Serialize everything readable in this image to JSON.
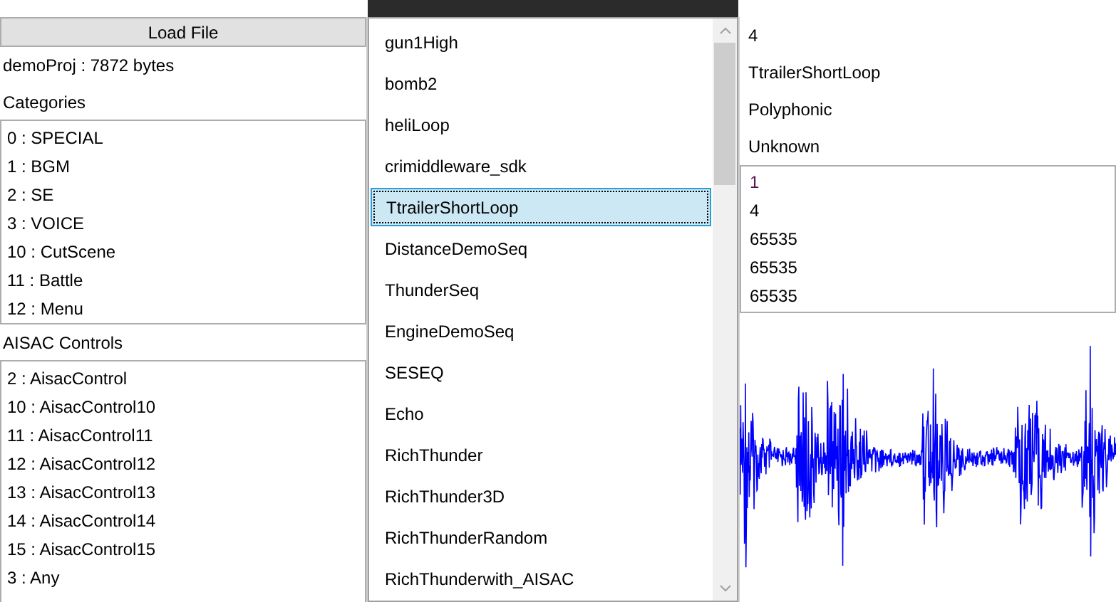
{
  "load_button": {
    "label": "Load File"
  },
  "file_info": "demoProj : 7872 bytes",
  "categories": {
    "heading": "Categories",
    "items": [
      "0 : SPECIAL",
      "1 : BGM",
      "2 : SE",
      "3 : VOICE",
      "10 : CutScene",
      "11 : Battle",
      "12 : Menu"
    ]
  },
  "aisac_controls": {
    "heading": "AISAC Controls",
    "items": [
      "2 : AisacControl",
      "10 : AisacControl10",
      "11 : AisacControl11",
      "12 : AisacControl12",
      "13 : AisacControl13",
      "14 : AisacControl14",
      "15 : AisacControl15",
      "3 : Any"
    ]
  },
  "cues": [
    {
      "label": "gun1High",
      "selected": false
    },
    {
      "label": "bomb2",
      "selected": false
    },
    {
      "label": "heliLoop",
      "selected": false
    },
    {
      "label": "crimiddleware_sdk",
      "selected": false
    },
    {
      "label": "TtrailerShortLoop",
      "selected": true
    },
    {
      "label": "DistanceDemoSeq",
      "selected": false
    },
    {
      "label": "ThunderSeq",
      "selected": false
    },
    {
      "label": "EngineDemoSeq",
      "selected": false
    },
    {
      "label": "SESEQ",
      "selected": false
    },
    {
      "label": "Echo",
      "selected": false
    },
    {
      "label": "RichThunder",
      "selected": false
    },
    {
      "label": "RichThunder3D",
      "selected": false
    },
    {
      "label": "RichThunderRandom",
      "selected": false
    },
    {
      "label": "RichThunderwith_AISAC",
      "selected": false
    }
  ],
  "cue_info": [
    "4",
    "TtrailerShortLoop",
    "Polyphonic",
    "Unknown"
  ],
  "cue_values": [
    {
      "text": "1",
      "color": "#5b1050"
    },
    {
      "text": "4",
      "color": "#000000"
    },
    {
      "text": "65535",
      "color": "#000000"
    },
    {
      "text": "65535",
      "color": "#000000"
    },
    {
      "text": "65535",
      "color": "#000000"
    }
  ]
}
